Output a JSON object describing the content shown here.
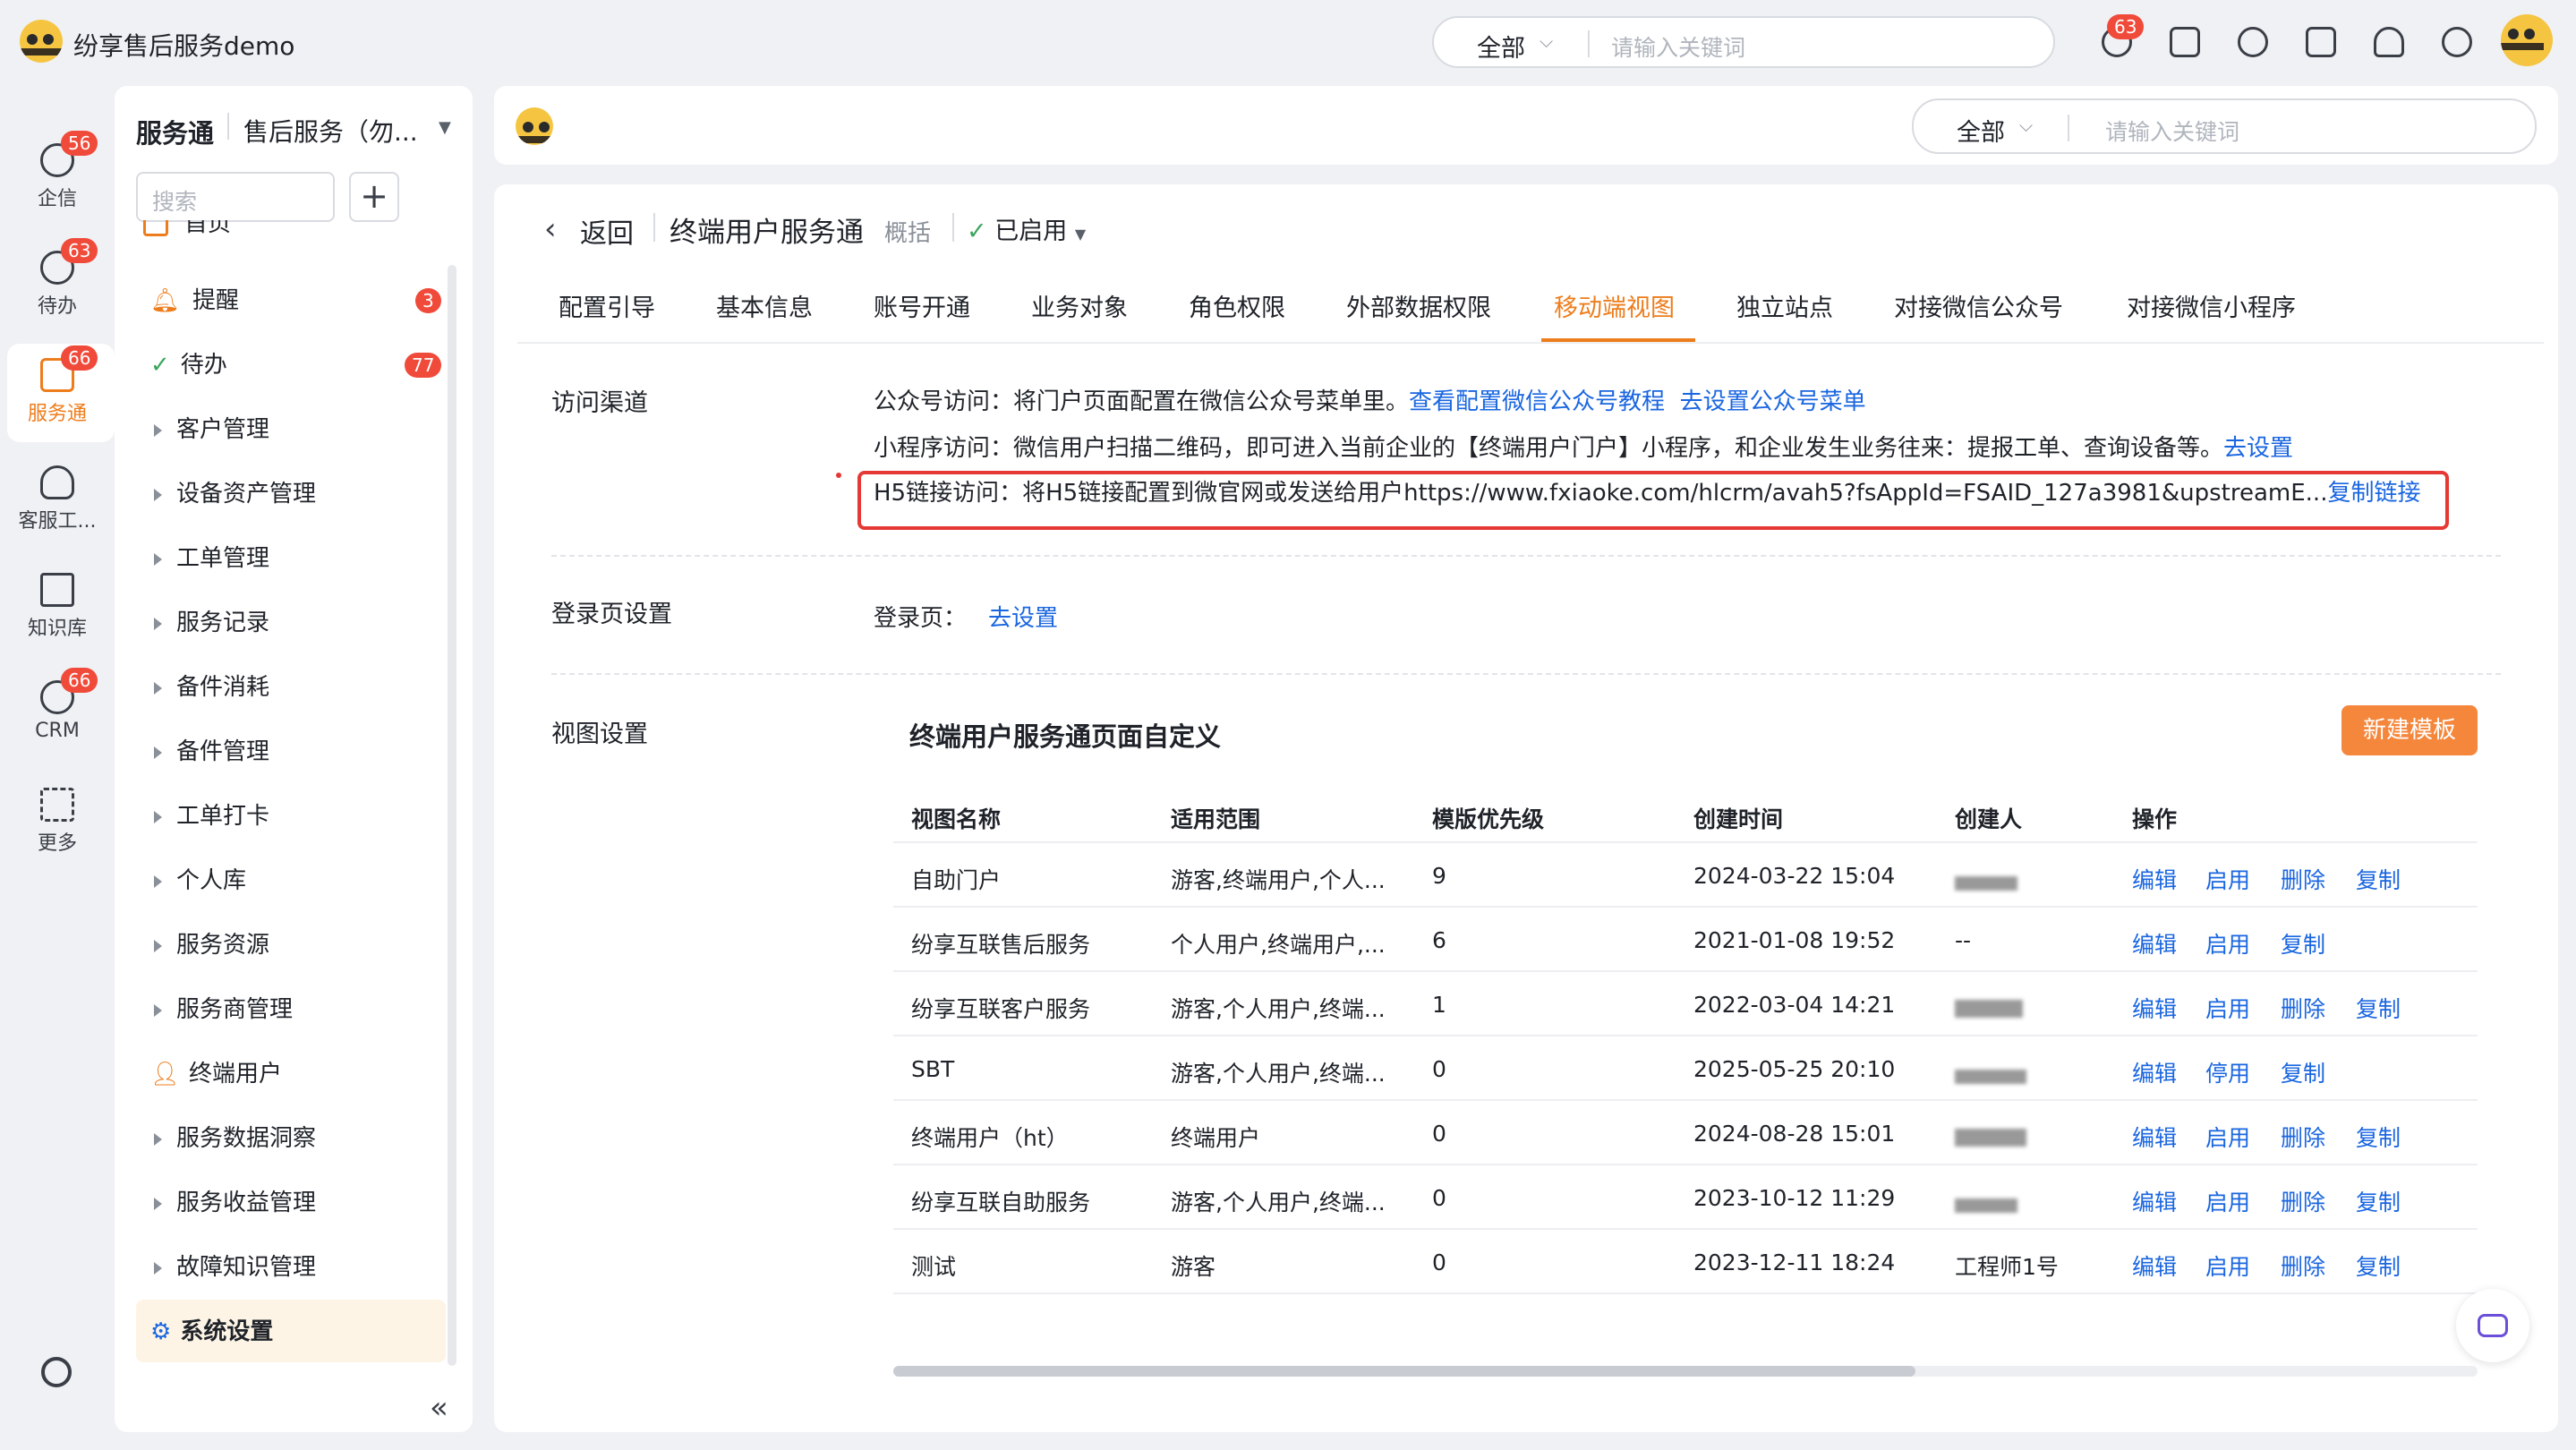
{
  "app": {
    "title": "纷享售后服务demo"
  },
  "global_search": {
    "scope": "全部",
    "placeholder": "请输入关键词"
  },
  "header_badge": "63",
  "nav": [
    {
      "label": "企信",
      "badge": "56"
    },
    {
      "label": "待办",
      "badge": "63"
    },
    {
      "label": "服务通",
      "badge": "66"
    },
    {
      "label": "客服工..."
    },
    {
      "label": "知识库"
    },
    {
      "label": "CRM",
      "badge": "66"
    },
    {
      "label": "更多"
    }
  ],
  "sidebar": {
    "title": "服务通",
    "subtitle": "售后服务（勿...",
    "search_placeholder": "搜索",
    "items": [
      {
        "label": "首页"
      },
      {
        "label": "提醒",
        "badge": "3"
      },
      {
        "label": "待办",
        "badge": "77"
      },
      {
        "label": "客户管理"
      },
      {
        "label": "设备资产管理"
      },
      {
        "label": "工单管理"
      },
      {
        "label": "服务记录"
      },
      {
        "label": "备件消耗"
      },
      {
        "label": "备件管理"
      },
      {
        "label": "工单打卡"
      },
      {
        "label": "个人库"
      },
      {
        "label": "服务资源"
      },
      {
        "label": "服务商管理"
      },
      {
        "label": "终端用户"
      },
      {
        "label": "服务数据洞察"
      },
      {
        "label": "服务收益管理"
      },
      {
        "label": "故障知识管理"
      },
      {
        "label": "系统设置"
      }
    ]
  },
  "content_search": {
    "scope": "全部",
    "placeholder": "请输入关键词"
  },
  "page": {
    "back": "返回",
    "title": "终端用户服务通",
    "overview": "概括",
    "status": "已启用"
  },
  "tabs": [
    "配置引导",
    "基本信息",
    "账号开通",
    "业务对象",
    "角色权限",
    "外部数据权限",
    "移动端视图",
    "独立站点",
    "对接微信公众号",
    "对接微信小程序"
  ],
  "access": {
    "label": "访问渠道",
    "line1": {
      "text": "公众号访问：将门户页面配置在微信公众号菜单里。",
      "link1": "查看配置微信公众号教程",
      "link2": "去设置公众号菜单"
    },
    "line2": {
      "text": "小程序访问：微信用户扫描二维码，即可进入当前企业的【终端用户门户】小程序，和企业发生业务往来：提报工单、查询设备等。",
      "link": "去设置"
    },
    "line3": {
      "text": "H5链接访问：将H5链接配置到微官网或发送给用户https://www.fxiaoke.com/hlcrm/avah5?fsAppId=FSAID_127a3981&upstreamE...",
      "link": "复制链接"
    }
  },
  "login": {
    "label": "登录页设置",
    "text": "登录页：",
    "link": "去设置"
  },
  "view": {
    "label": "视图设置",
    "title": "终端用户服务通页面自定义",
    "new_button": "新建模板",
    "columns": [
      "视图名称",
      "适用范围",
      "模版优先级",
      "创建时间",
      "创建人",
      "操作"
    ],
    "rows": [
      {
        "name": "自助门户",
        "scope": "游客,终端用户,个人...",
        "priority": "9",
        "time": "2024-03-22 15:04",
        "creator": "",
        "actions": [
          "编辑",
          "启用",
          "删除",
          "复制"
        ]
      },
      {
        "name": "纷享互联售后服务",
        "scope": "个人用户,终端用户,...",
        "priority": "6",
        "time": "2021-01-08 19:52",
        "creator": "--",
        "actions": [
          "编辑",
          "启用",
          "复制"
        ]
      },
      {
        "name": "纷享互联客户服务",
        "scope": "游客,个人用户,终端...",
        "priority": "1",
        "time": "2022-03-04 14:21",
        "creator": "",
        "actions": [
          "编辑",
          "启用",
          "删除",
          "复制"
        ]
      },
      {
        "name": "SBT",
        "scope": "游客,个人用户,终端...",
        "priority": "0",
        "time": "2025-05-25 20:10",
        "creator": "",
        "actions": [
          "编辑",
          "停用",
          "复制"
        ]
      },
      {
        "name": "终端用户（ht）",
        "scope": "终端用户",
        "priority": "0",
        "time": "2024-08-28 15:01",
        "creator": "",
        "actions": [
          "编辑",
          "启用",
          "删除",
          "复制"
        ]
      },
      {
        "name": "纷享互联自助服务",
        "scope": "游客,个人用户,终端...",
        "priority": "0",
        "time": "2023-10-12 11:29",
        "creator": "",
        "actions": [
          "编辑",
          "启用",
          "删除",
          "复制"
        ]
      },
      {
        "name": "测试",
        "scope": "游客",
        "priority": "0",
        "time": "2023-12-11 18:24",
        "creator": "工程师1号",
        "actions": [
          "编辑",
          "启用",
          "删除",
          "复制"
        ]
      }
    ]
  }
}
